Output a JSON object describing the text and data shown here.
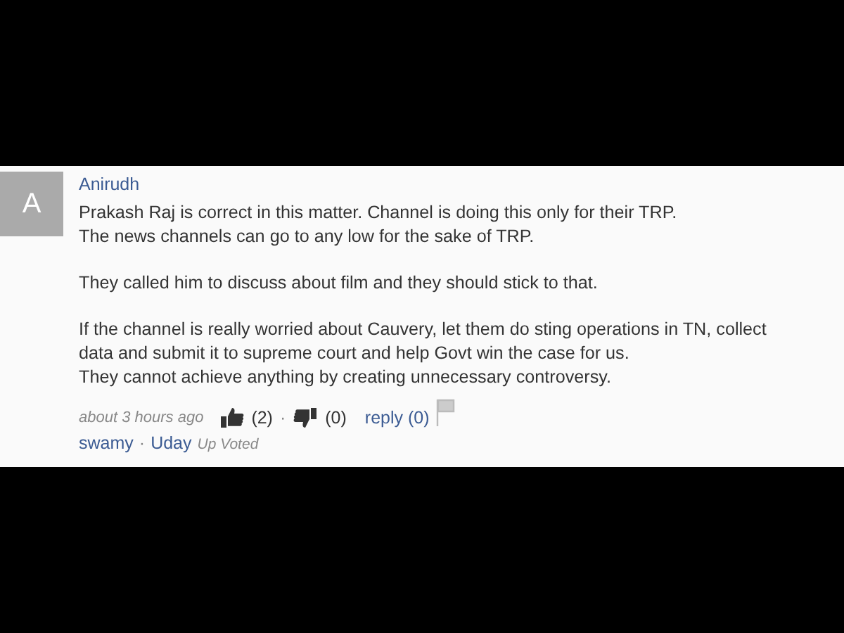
{
  "comment": {
    "avatar": "A",
    "author": "Anirudh",
    "paragraphs": [
      "Prakash Raj is correct in this matter. Channel is doing this only for their TRP.\nThe news channels can go to any low for the sake of TRP.",
      "They called him to discuss about film and they should stick to that.",
      "If the channel is really worried about Cauvery, let them do sting operations in TN, collect\ndata and submit it to supreme court and help Govt win the case for us.\nThey cannot achieve anything by creating unnecessary controversy."
    ],
    "time": "about 3 hours ago",
    "upvotes": "(2)",
    "separator": "·",
    "downvotes": "(0)",
    "reply": "reply (0)",
    "voters": [
      {
        "name": "swamy"
      },
      {
        "name": "Uday"
      }
    ],
    "voter_separator": "·",
    "vote_label": "Up Voted"
  }
}
